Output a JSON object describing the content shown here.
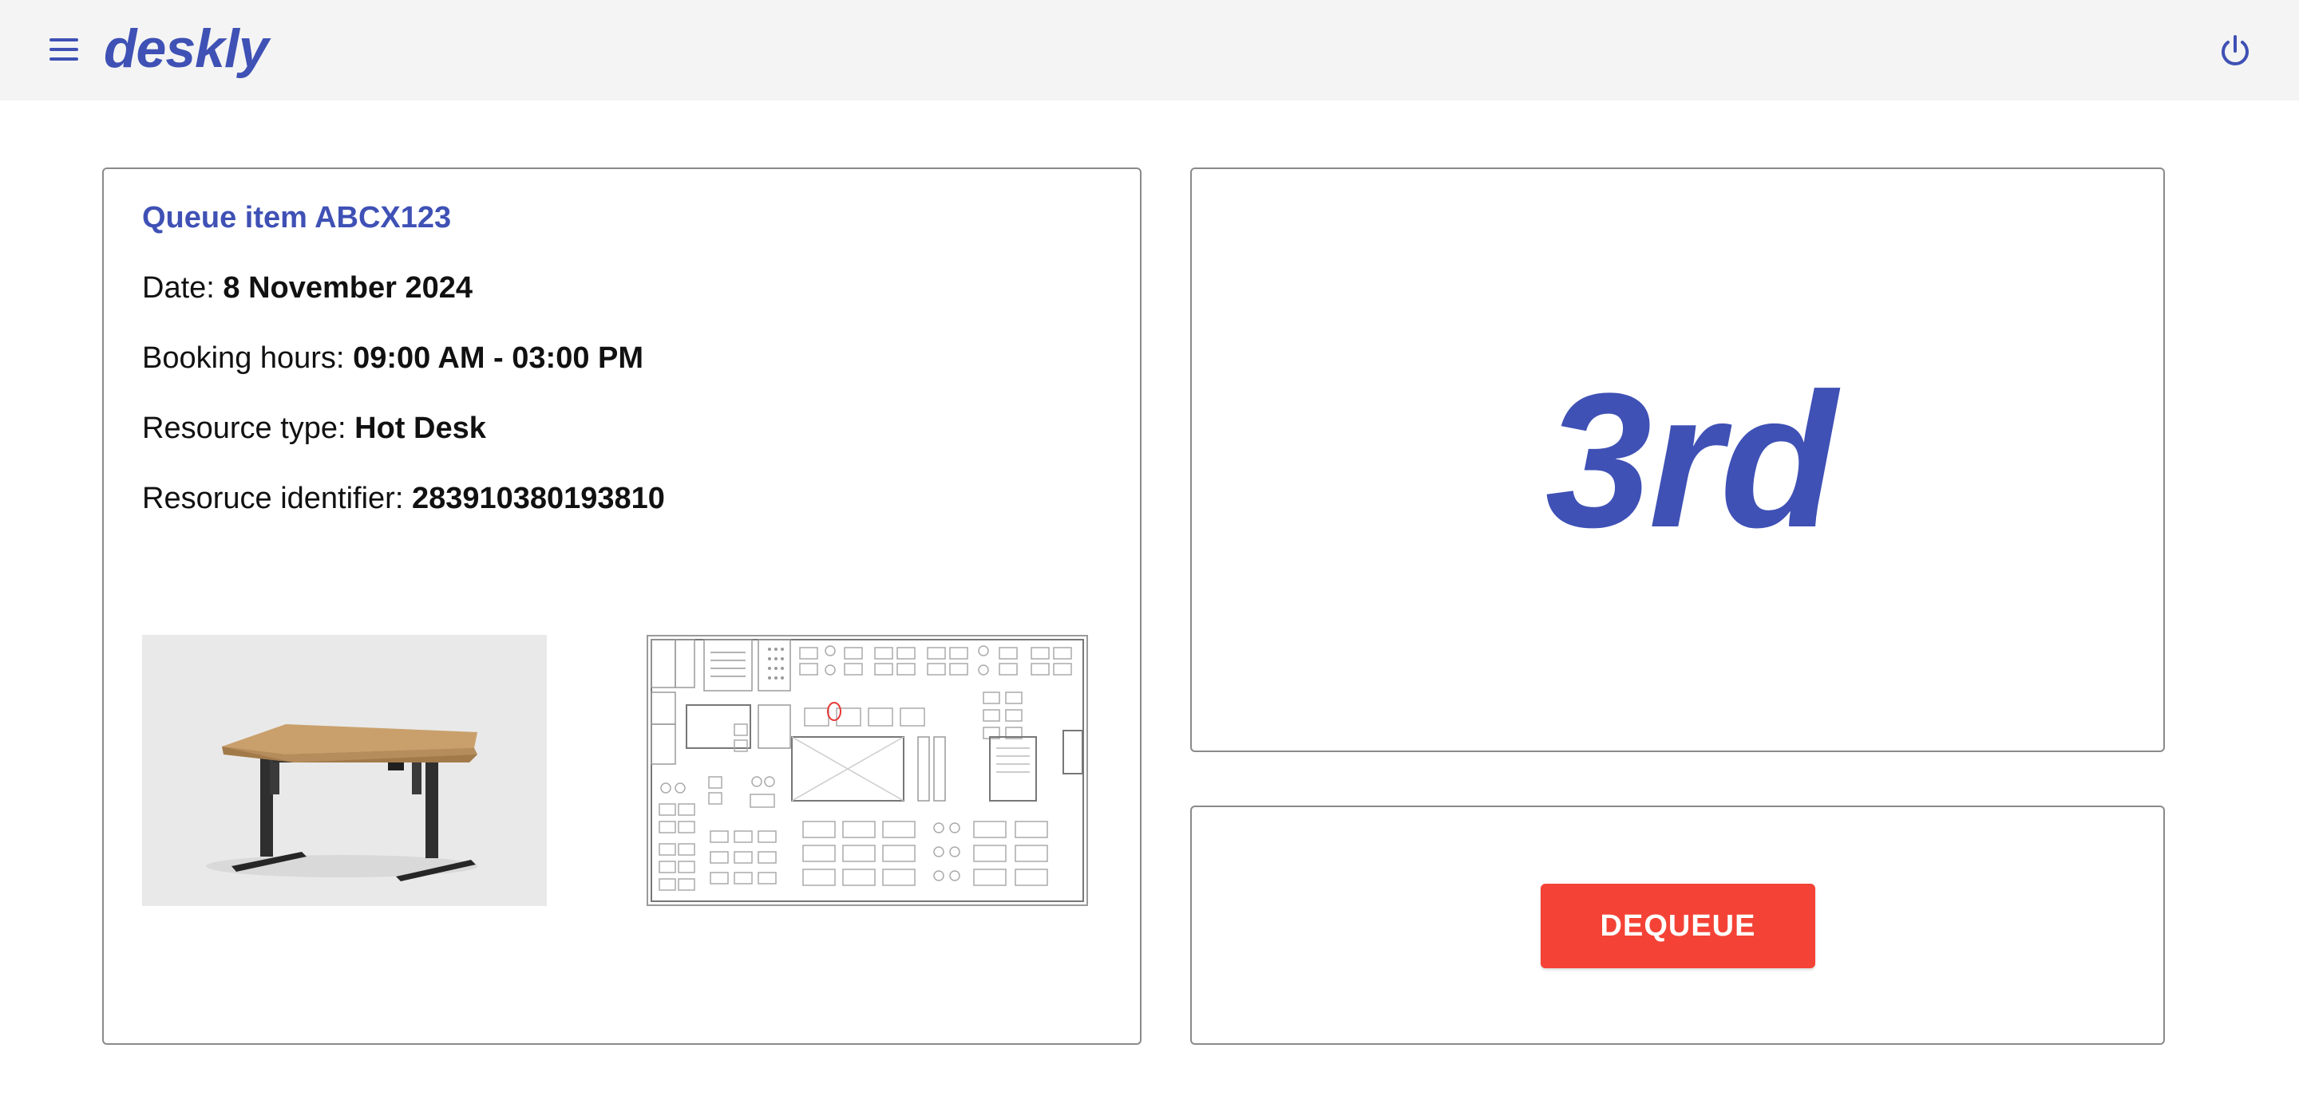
{
  "app": {
    "logo": "deskly",
    "menu_icon": "menu-icon",
    "power_icon": "power-icon"
  },
  "queue_item": {
    "title": "Queue item ABCX123",
    "date_label": "Date: ",
    "date_value": "8 November 2024",
    "hours_label": "Booking hours: ",
    "hours_value": "09:00 AM - 03:00 PM",
    "type_label": "Resource type: ",
    "type_value": "Hot Desk",
    "identifier_label": "Resoruce identifier: ",
    "identifier_value": "283910380193810"
  },
  "queue_position": {
    "ordinal": "3rd"
  },
  "actions": {
    "dequeue_label": "DEQUEUE"
  },
  "colors": {
    "primary": "#3f51b5",
    "danger": "#f44336",
    "header_bg": "#f4f4f4",
    "highlight_marker": "#e53935"
  }
}
